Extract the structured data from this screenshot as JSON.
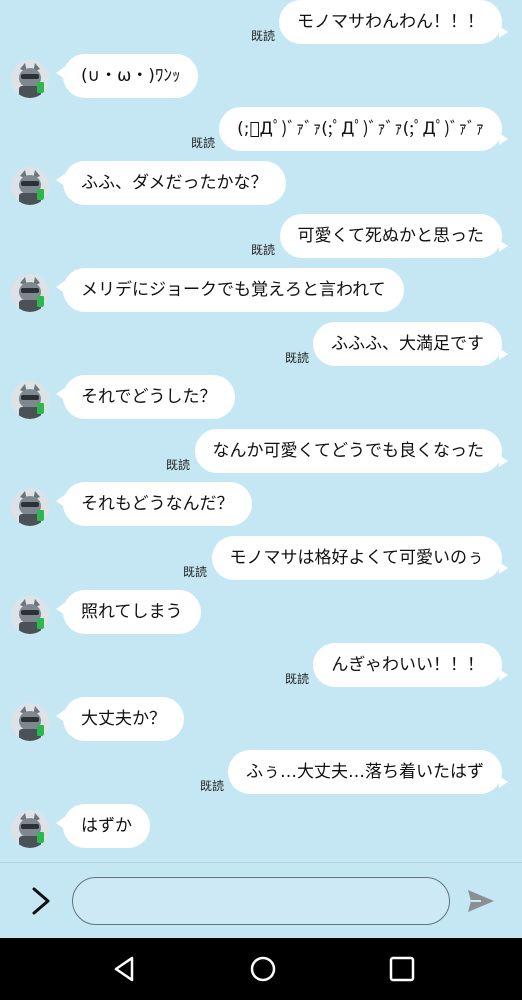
{
  "chat": {
    "read_label": "既読",
    "messages": [
      {
        "side": "out",
        "text": "モノマサわんわん！！！"
      },
      {
        "side": "in",
        "text": "(∪・ω・)ﾜﾝｯ"
      },
      {
        "side": "out",
        "text": "(;ﾟДﾟ)ﾞｧﾞｧ(;ﾟДﾟ)ﾞｧﾞｧ(;ﾟДﾟ)ﾞｧﾞｧ"
      },
      {
        "side": "in",
        "text": "ふふ、ダメだったかな？"
      },
      {
        "side": "out",
        "text": "可愛くて死ぬかと思った"
      },
      {
        "side": "in",
        "text": "メリデにジョークでも覚えろと言われて"
      },
      {
        "side": "out",
        "text": "ふふふ、大満足です"
      },
      {
        "side": "in",
        "text": "それでどうした？"
      },
      {
        "side": "out",
        "text": "なんか可愛くてどうでも良くなった"
      },
      {
        "side": "in",
        "text": "それもどうなんだ？"
      },
      {
        "side": "out",
        "text": "モノマサは格好よくて可愛いのぅ"
      },
      {
        "side": "in",
        "text": "照れてしまう"
      },
      {
        "side": "out",
        "text": "んぎゃわいい！！！"
      },
      {
        "side": "in",
        "text": "大丈夫か？"
      },
      {
        "side": "out",
        "text": "ふぅ…大丈夫…落ち着いたはず"
      },
      {
        "side": "in",
        "text": "はずか"
      }
    ]
  },
  "composer": {
    "input_value": "",
    "input_placeholder": "",
    "expand_icon": "chevron-right-icon",
    "send_icon": "send-icon"
  },
  "navbar": {
    "icons": [
      "back-triangle-icon",
      "home-circle-icon",
      "recents-square-icon"
    ]
  },
  "colors": {
    "background": "#c5e7f4",
    "bubble": "#ffffff",
    "navbar": "#000000"
  }
}
